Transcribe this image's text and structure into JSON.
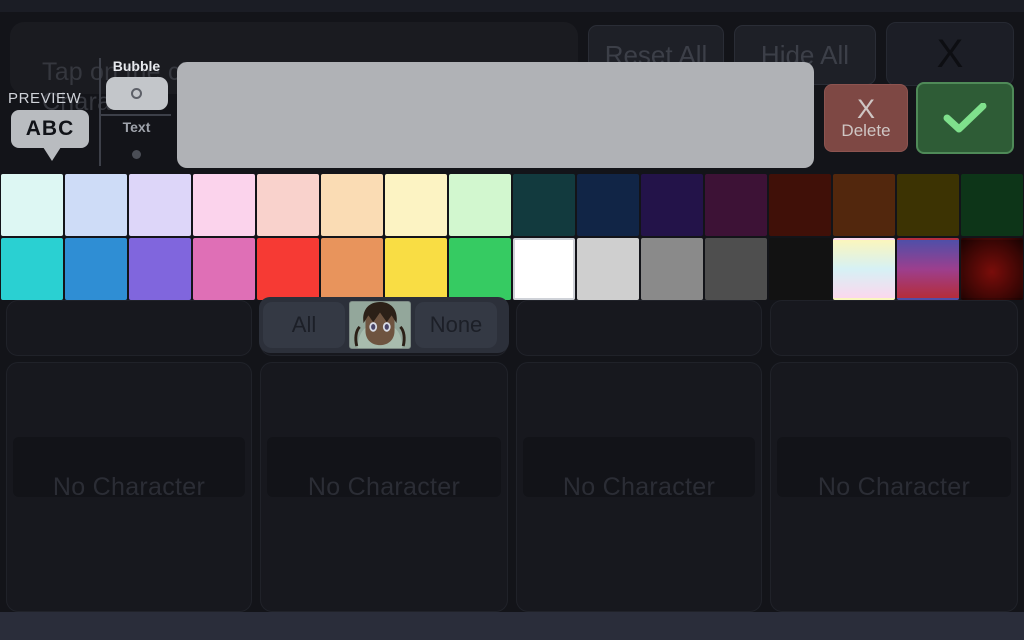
{
  "window": {
    "bottom_bar_color": "#2a2d3a",
    "background_color": "#131419"
  },
  "instructions": {
    "line1": "Tap on the chat bubble to input new text.",
    "line2": "Characters"
  },
  "header_buttons": {
    "reset_all": "Reset All",
    "hide_all": "Hide All",
    "close": "X"
  },
  "preview": {
    "label": "PREVIEW",
    "bubble_text": "ABC",
    "bubble_color": "#b9bcc0"
  },
  "mode_selector": {
    "bubble_label": "Bubble",
    "text_label": "Text",
    "selected": "Bubble"
  },
  "actions": {
    "delete_glyph": "X",
    "delete_label": "Delete",
    "delete_color": "#7e4844",
    "confirm_icon": "check-icon",
    "confirm_color": "#2e5c36",
    "confirm_border": "#4f8a58"
  },
  "character_selector": {
    "all_label": "All",
    "none_label": "None",
    "thumbnail": "character-avatar"
  },
  "palette": {
    "selected_index": 24,
    "rows": [
      {
        "name": "pastel-and-dark-row",
        "swatches": [
          {
            "name": "pale-mint",
            "color": "#ddf7f3",
            "type": "solid"
          },
          {
            "name": "pale-periwinkle",
            "color": "#cedcf7",
            "type": "solid"
          },
          {
            "name": "pale-lavender",
            "color": "#ddd6f9",
            "type": "solid"
          },
          {
            "name": "pale-pink",
            "color": "#fbd3ec",
            "type": "solid"
          },
          {
            "name": "pale-salmon",
            "color": "#f9d2cc",
            "type": "solid"
          },
          {
            "name": "pale-peach",
            "color": "#fadcb4",
            "type": "solid"
          },
          {
            "name": "pale-cream",
            "color": "#fcf3c3",
            "type": "solid"
          },
          {
            "name": "pale-green",
            "color": "#d2f7cf",
            "type": "solid"
          },
          {
            "name": "dark-teal",
            "color": "#123a3e",
            "type": "solid"
          },
          {
            "name": "dark-navy",
            "color": "#112546",
            "type": "solid"
          },
          {
            "name": "dark-indigo",
            "color": "#231349",
            "type": "solid"
          },
          {
            "name": "dark-plum",
            "color": "#3d1236",
            "type": "solid"
          },
          {
            "name": "dark-maroon",
            "color": "#401008",
            "type": "solid"
          },
          {
            "name": "dark-brown",
            "color": "#52270d",
            "type": "solid"
          },
          {
            "name": "dark-olive",
            "color": "#3c3303",
            "type": "solid"
          },
          {
            "name": "dark-forest",
            "color": "#0d3518",
            "type": "solid"
          }
        ]
      },
      {
        "name": "vivid-and-neutral-row",
        "swatches": [
          {
            "name": "turquoise",
            "color": "#2ad0d2",
            "type": "solid"
          },
          {
            "name": "blue",
            "color": "#2f8ed4",
            "type": "solid"
          },
          {
            "name": "purple",
            "color": "#8066dd",
            "type": "solid"
          },
          {
            "name": "pink",
            "color": "#df6fb6",
            "type": "solid"
          },
          {
            "name": "red",
            "color": "#f63a34",
            "type": "solid"
          },
          {
            "name": "orange",
            "color": "#e8945c",
            "type": "solid"
          },
          {
            "name": "yellow",
            "color": "#f9dd44",
            "type": "solid"
          },
          {
            "name": "green",
            "color": "#36cb62",
            "type": "solid"
          },
          {
            "name": "white",
            "color": "#ffffff",
            "type": "solid"
          },
          {
            "name": "light-gray",
            "color": "#cfcfcf",
            "type": "solid"
          },
          {
            "name": "medium-gray",
            "color": "#8a8a8a",
            "type": "solid"
          },
          {
            "name": "dark-gray",
            "color": "#4e4e4e",
            "type": "solid"
          },
          {
            "name": "near-black",
            "color": "#121212",
            "type": "solid"
          },
          {
            "name": "pastel-gradient",
            "color": "linear-gradient(180deg,#fbf6bd 0%,#d6f1f5 50%,#fbd8ee 100%)",
            "type": "gradient"
          },
          {
            "name": "purple-red-gradient",
            "color": "linear-gradient(180deg,#4f4fa8 0%,#9c3f8e 50%,#b52d3a 100%)",
            "type": "gradient"
          },
          {
            "name": "dark-red-gradient",
            "color": "radial-gradient(circle at 50% 55%,#7a0d0a 0%,#3a0604 70%,#1c0302 100%)",
            "type": "gradient"
          }
        ]
      }
    ]
  },
  "character_slots": [
    {
      "name": "slot-1",
      "label": "No Character"
    },
    {
      "name": "slot-2",
      "label": "No Character"
    },
    {
      "name": "slot-3",
      "label": "No Character"
    },
    {
      "name": "slot-4",
      "label": "No Character"
    }
  ]
}
